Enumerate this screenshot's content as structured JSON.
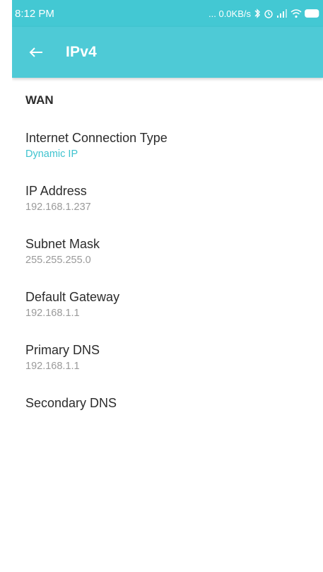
{
  "status_bar": {
    "time": "8:12 PM",
    "speed": "... 0.0KB/s",
    "icons": [
      "bluetooth-icon",
      "alarm-icon",
      "signal-icon",
      "wifi-icon",
      "battery-icon"
    ]
  },
  "app_bar": {
    "back_icon": "arrow-left-icon",
    "title": "IPv4"
  },
  "section_title": "WAN",
  "items": [
    {
      "label": "Internet Connection Type",
      "value": "Dynamic IP"
    },
    {
      "label": "IP Address",
      "value": "192.168.1.237"
    },
    {
      "label": "Subnet Mask",
      "value": "255.255.255.0"
    },
    {
      "label": "Default Gateway",
      "value": "192.168.1.1"
    },
    {
      "label": "Primary DNS",
      "value": "192.168.1.1"
    },
    {
      "label": "Secondary DNS",
      "value": ""
    }
  ],
  "colors": {
    "status_bar": "#43c8d3",
    "app_bar": "#4ecad6",
    "accent_value": "#3fc3cf",
    "value_gray": "#9a9a9a",
    "label_text": "#2c2c2c"
  }
}
